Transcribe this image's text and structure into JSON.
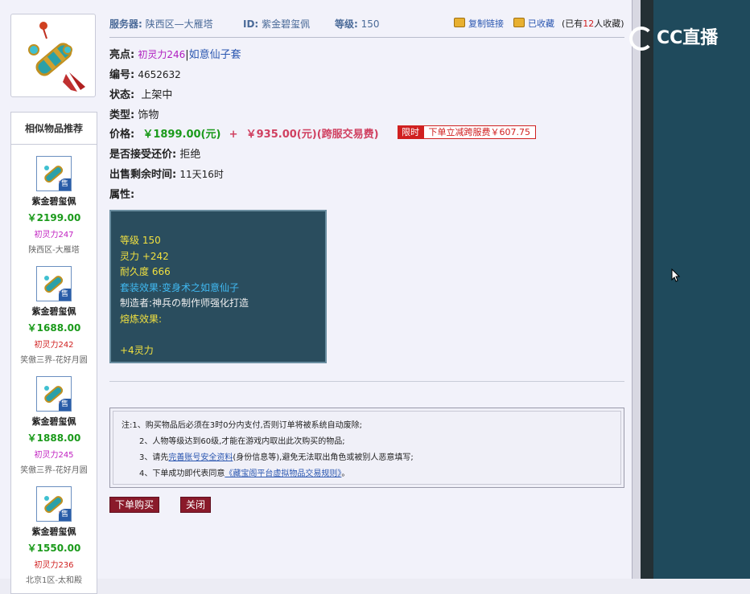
{
  "header": {
    "server_label": "服务器:",
    "server_value": "陕西区—大雁塔",
    "id_label": "ID:",
    "id_value": "紫金碧玺佩",
    "level_label": "等级:",
    "level_value": "150",
    "copy_link": "复制链接",
    "favorited": "已收藏",
    "fav_count_prefix": "(已有",
    "fav_count": "12",
    "fav_count_suffix": "人收藏)"
  },
  "details": {
    "highlight_label": "亮点:",
    "highlight_value": "初灵力246",
    "highlight_sep": "|",
    "highlight_set": "如意仙子套",
    "number_label": "编号:",
    "number_value": "4652632",
    "status_label": "状态:",
    "status_value": "上架中",
    "type_label": "类型:",
    "type_value": "饰物",
    "price_label": "价格:",
    "price_value": "￥1899.00(元)",
    "price_plus": "+",
    "price_fee": "￥935.00(元)(跨服交易费)",
    "limit_tag": "限时",
    "limit_desc": "下单立减跨服费￥607.75",
    "bargain_label": "是否接受还价:",
    "bargain_value": "拒绝",
    "time_label": "出售剩余时间:",
    "time_value": "11天16时",
    "attr_label": "属性:"
  },
  "attributes": {
    "level": "等级 150",
    "spirit": "灵力 +242",
    "durability": "耐久度 666",
    "set_effect": "套装效果:变身术之如意仙子",
    "maker": "制造者:神兵の制作师强化打造",
    "refine": "熔炼效果:",
    "refine_value": "+4灵力"
  },
  "notes": {
    "n1": "注:1、购买物品后必须在3时0分内支付,否则订单将被系统自动废除;",
    "n2": "2、人物等级达到60级,才能在游戏内取出此次购买的物品;",
    "n3a": "3、请先",
    "n3link": "完善账号安全资料",
    "n3b": "(身份信息等),避免无法取出角色或被别人恶意填写;",
    "n4a": "4、下单成功即代表同意",
    "n4link": "《藏宝阁平台虚拟物品交易规则》",
    "n4b": "。"
  },
  "buttons": {
    "buy": "下单购买",
    "close": "关闭"
  },
  "recommend": {
    "title": "相似物品推荐",
    "sale_tag": "售",
    "items": [
      {
        "name": "紫金碧玺佩",
        "price": "￥2199.00",
        "attr": "初灵力247",
        "server": "陕西区-大雁塔"
      },
      {
        "name": "紫金碧玺佩",
        "price": "￥1688.00",
        "attr": "初灵力242",
        "server": "笑傲三界-花好月圆"
      },
      {
        "name": "紫金碧玺佩",
        "price": "￥1888.00",
        "attr": "初灵力245",
        "server": "笑傲三界-花好月圆"
      },
      {
        "name": "紫金碧玺佩",
        "price": "￥1550.00",
        "attr": "初灵力236",
        "server": "北京1区-太和殿"
      }
    ]
  },
  "logo": {
    "text": "CC直播"
  },
  "colors": {
    "accent_green": "#1a9a1a",
    "accent_red": "#d02020",
    "attr_bg": "#2a4d5e",
    "stream_bg": "#1f4a5c"
  }
}
